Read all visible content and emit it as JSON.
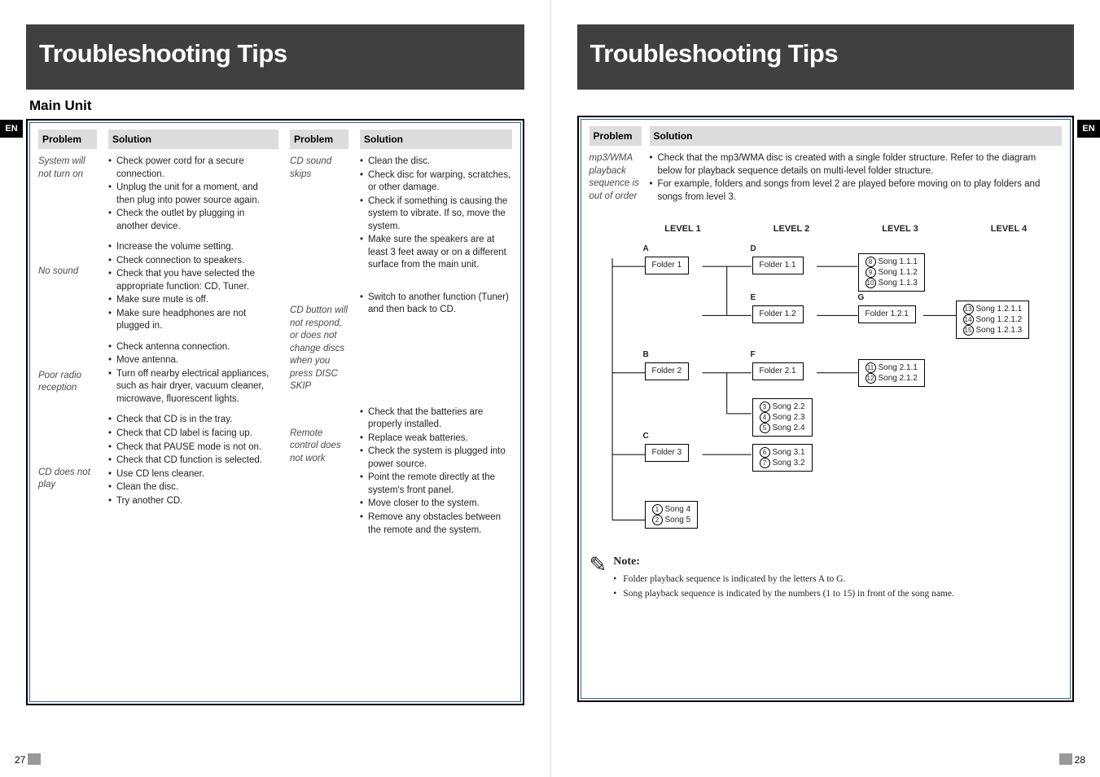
{
  "lang_tag": "EN",
  "page_left_num": "27",
  "page_right_num": "28",
  "left": {
    "title": "Troubleshooting Tips",
    "subtitle": "Main Unit",
    "headers": {
      "problem": "Problem",
      "solution": "Solution"
    },
    "colA": [
      {
        "problem": "System will not turn on",
        "items": [
          "Check power cord for a secure connection.",
          "Unplug the unit for a moment, and then plug into power source again.",
          "Check the outlet by plugging in another device."
        ]
      },
      {
        "problem": "No sound",
        "items": [
          "Increase the volume setting.",
          "Check connection to speakers.",
          "Check that you have selected the appropriate function: CD, Tuner.",
          "Make sure mute is off.",
          "Make sure headphones are not plugged in."
        ]
      },
      {
        "problem": "Poor radio reception",
        "items": [
          "Check antenna connection.",
          "Move antenna.",
          "Turn off nearby electrical appliances, such as hair dryer, vacuum cleaner, microwave, fluorescent lights."
        ]
      },
      {
        "problem": "CD does not play",
        "items": [
          "Check that CD is in the tray.",
          "Check that CD label is facing up.",
          "Check that PAUSE mode is not on.",
          "Check that CD function is selected.",
          "Use CD lens cleaner.",
          "Clean the disc.",
          "Try another CD."
        ]
      }
    ],
    "colB": [
      {
        "problem": "CD sound skips",
        "items": [
          "Clean the disc.",
          "Check disc for warping, scratches, or other damage.",
          "Check if something is causing the system to  vibrate. If so, move the  system.",
          "Make sure the speakers are at least 3 feet away or on a different surface from the main unit."
        ]
      },
      {
        "problem": "CD button will not respond, or does not change discs when you press DISC SKIP",
        "items": [
          "Switch to another function (Tuner) and then back to CD."
        ]
      },
      {
        "problem": "Remote control does not work",
        "items": [
          "Check that the batteries are properly installed.",
          "Replace weak batteries.",
          "Check the system is plugged into power source.",
          "Point the remote directly at the system's front panel.",
          "Move closer to the system.",
          "Remove any obstacles between the remote and the system."
        ]
      }
    ]
  },
  "right": {
    "title": "Troubleshooting Tips",
    "headers": {
      "problem": "Problem",
      "solution": "Solution"
    },
    "block": {
      "problem": "mp3/WMA playback sequence is out of order",
      "items": [
        "Check that the mp3/WMA disc is created with a single folder structure. Refer to the diagram below for playback sequence details on multi-level folder structure.",
        "For example, folders and songs from level 2 are played before moving on to play folders and songs from level 3."
      ]
    },
    "levels": [
      "LEVEL 1",
      "LEVEL 2",
      "LEVEL 3",
      "LEVEL 4"
    ],
    "diagram": {
      "letters": {
        "A": "A",
        "B": "B",
        "C": "C",
        "D": "D",
        "E": "E",
        "F": "F",
        "G": "G"
      },
      "folders": {
        "f1": "Folder 1",
        "f2": "Folder 2",
        "f3": "Folder 3",
        "f11": "Folder 1.1",
        "f12": "Folder 1.2",
        "f21": "Folder 2.1",
        "f121": "Folder 1.2.1"
      },
      "songs": {
        "s4": "Song 4",
        "s5": "Song 5",
        "s31": "Song 3.1",
        "s32": "Song 3.2",
        "s22": "Song 2.2",
        "s23": "Song 2.3",
        "s24": "Song 2.4",
        "s111": "Song 1.1.1",
        "s112": "Song 1.1.2",
        "s113": "Song 1.1.3",
        "s211": "Song 2.1.1",
        "s212": "Song 2.1.2",
        "s1211": "Song 1.2.1.1",
        "s1212": "Song 1.2.1.2",
        "s1213": "Song 1.2.1.3"
      },
      "order": {
        "s4": "1",
        "s5": "2",
        "s22": "3",
        "s23": "4",
        "s24": "5",
        "s31": "6",
        "s32": "7",
        "s111": "8",
        "s112": "9",
        "s113": "10",
        "s211": "11",
        "s212": "12",
        "s1211": "13",
        "s1212": "14",
        "s1213": "15"
      }
    },
    "note": {
      "head": "Note:",
      "items": [
        "Folder playback sequence is indicated by the letters A to G.",
        "Song playback sequence is indicated by the numbers (1 to 15) in front of the song name."
      ]
    }
  }
}
